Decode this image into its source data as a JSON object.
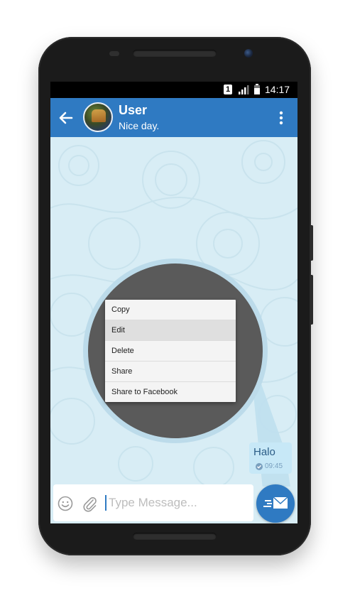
{
  "status_bar": {
    "sim_number": "1",
    "time": "14:17"
  },
  "header": {
    "user_name": "User",
    "user_status": "Nice day."
  },
  "context_menu": {
    "items": [
      {
        "label": "Copy"
      },
      {
        "label": "Edit"
      },
      {
        "label": "Delete"
      },
      {
        "label": "Share"
      },
      {
        "label": "Share to Facebook"
      }
    ],
    "highlighted": "Edit"
  },
  "message": {
    "text": "Halo",
    "time": "09:45"
  },
  "composer": {
    "placeholder": "Type Message..."
  },
  "colors": {
    "accent": "#2f7ac2",
    "chat_background": "#d8edf5",
    "bubble": "#c7e8f7"
  },
  "icons": [
    "back-arrow-icon",
    "more-vertical-icon",
    "emoji-icon",
    "paperclip-icon",
    "send-mail-icon",
    "check-icon",
    "signal-icon",
    "battery-icon"
  ]
}
